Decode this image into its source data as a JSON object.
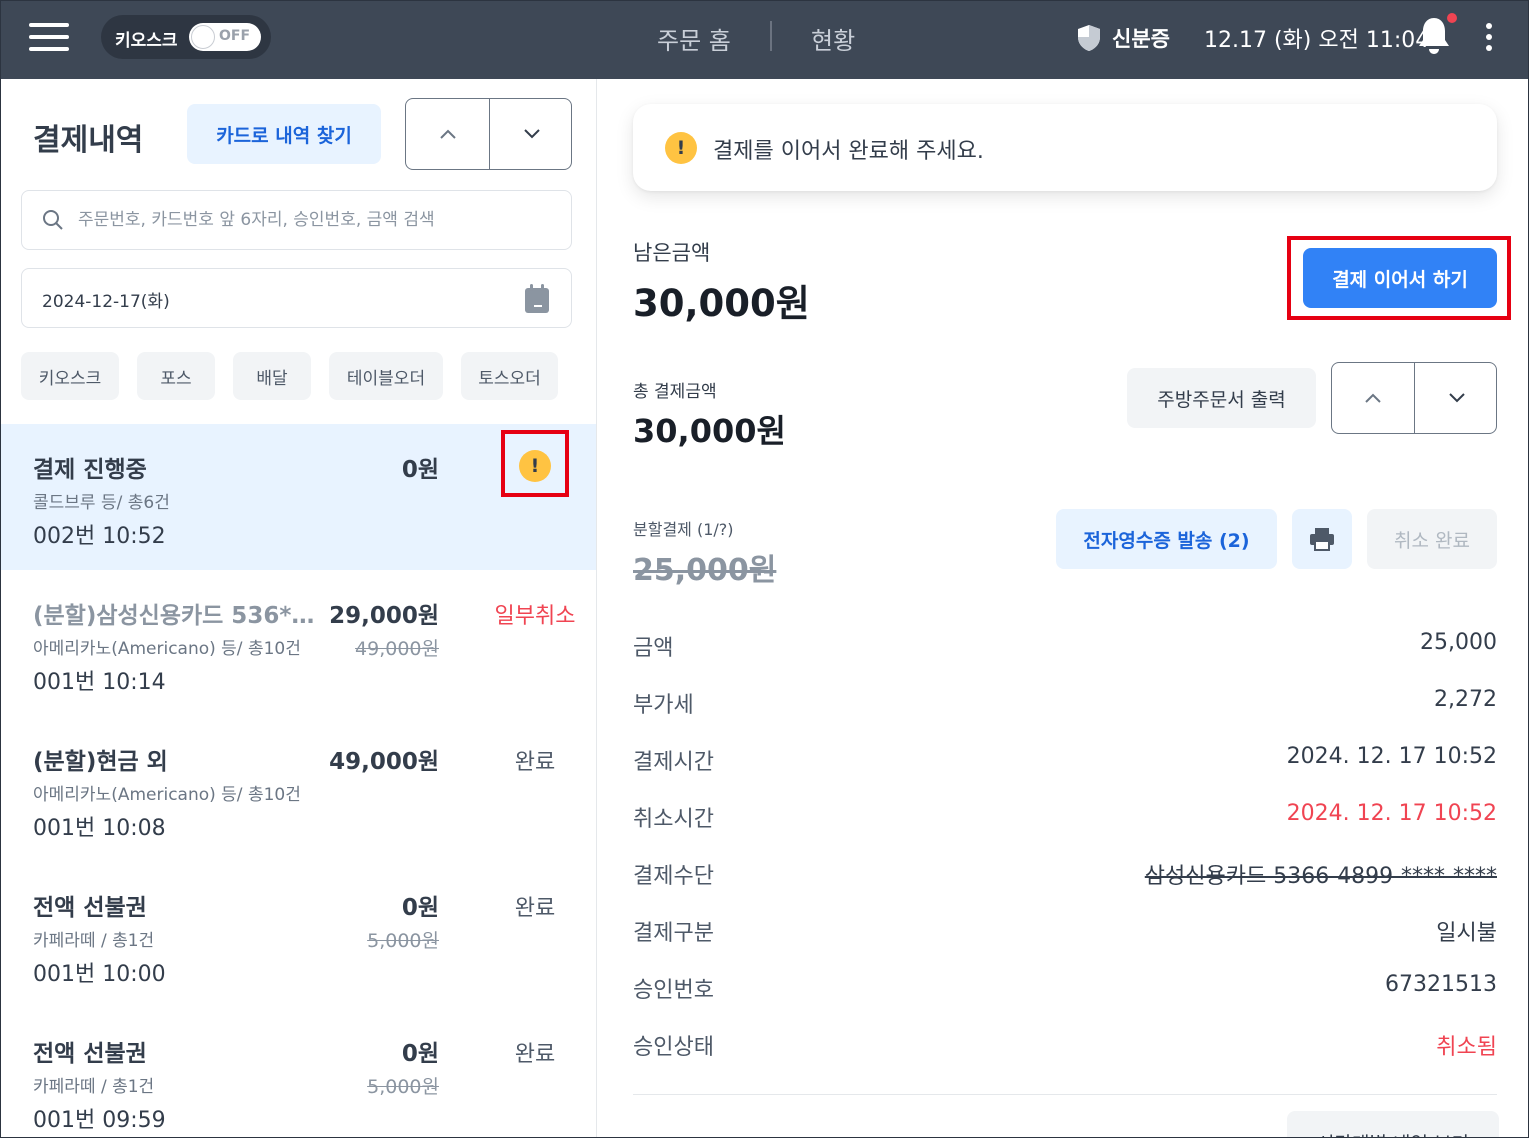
{
  "header": {
    "kiosk_label": "키오스크",
    "kiosk_toggle": "OFF",
    "nav_home": "주문 홈",
    "nav_status": "현황",
    "id_label": "신분증",
    "datetime": "12.17 (화) 오전 11:04"
  },
  "left": {
    "title": "결제내역",
    "card_find": "카드로 내역 찾기",
    "search_placeholder": "주문번호, 카드번호 앞 6자리, 승인번호, 금액 검색",
    "date": "2024-12-17(화)",
    "chips": [
      "키오스크",
      "포스",
      "배달",
      "테이블오더",
      "토스오더"
    ],
    "items": [
      {
        "title": "결제 진행중",
        "sub": "콜드브루 등/ 총6건",
        "time": "002번 10:52",
        "amount": "0원",
        "orig": "",
        "status": "!"
      },
      {
        "title": "(분할)삼성신용카드 536*…",
        "sub": "아메리카노(Americano) 등/ 총10건",
        "time": "001번 10:14",
        "amount": "29,000원",
        "orig": "49,000원",
        "status": "일부취소"
      },
      {
        "title": "(분할)현금 외",
        "sub": "아메리카노(Americano) 등/ 총10건",
        "time": "001번 10:08",
        "amount": "49,000원",
        "orig": "",
        "status": "완료"
      },
      {
        "title": "전액 선불권",
        "sub": "카페라떼 / 총1건",
        "time": "001번 10:00",
        "amount": "0원",
        "orig": "5,000원",
        "status": "완료"
      },
      {
        "title": "전액 선불권",
        "sub": "카페라떼 / 총1건",
        "time": "001번 09:59",
        "amount": "0원",
        "orig": "5,000원",
        "status": "완료"
      }
    ]
  },
  "right": {
    "alert": "결제를 이어서 완료해 주세요.",
    "remain_label": "남은금액",
    "remain_value": "30,000원",
    "continue_btn": "결제 이어서 하기",
    "total_label": "총 결제금액",
    "total_value": "30,000원",
    "kitchen_btn": "주방주문서 출력",
    "split_label": "분할결제 (1/?)",
    "split_value": "25,000원",
    "ereceipt_btn": "전자영수증 발송 (2)",
    "cancel_done_btn": "취소 완료",
    "details": [
      {
        "label": "금액",
        "value": "25,000"
      },
      {
        "label": "부가세",
        "value": "2,272"
      },
      {
        "label": "결제시간",
        "value": "2024. 12. 17 10:52"
      },
      {
        "label": "취소시간",
        "value": "2024. 12. 17 10:52"
      },
      {
        "label": "결제수단",
        "value": "삼성신용카드 5366-4899-****-****"
      },
      {
        "label": "결제구분",
        "value": "일시불"
      },
      {
        "label": "승인번호",
        "value": "67321513"
      },
      {
        "label": "승인상태",
        "value": "취소됨"
      }
    ],
    "bottom_btn": "시간대별 내역 보기"
  },
  "colors": {
    "topbar": "#3e4856",
    "primary": "#3182f6",
    "selected_row": "#e8f3ff",
    "warning": "#ffc342",
    "danger": "#f04452",
    "highlight_box": "#e60012"
  }
}
